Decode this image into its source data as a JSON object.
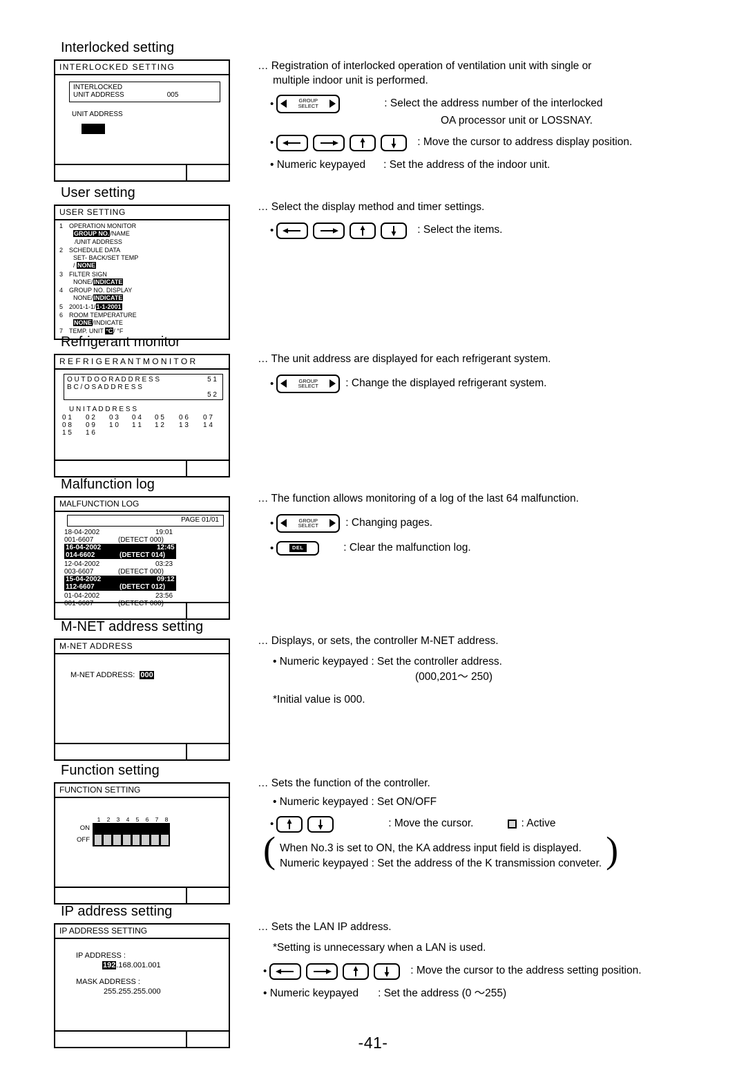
{
  "page": {
    "number": "-41-"
  },
  "sections": [
    {
      "title": "Interlocked setting",
      "screen_title": "INTERLOCKED  SETTING",
      "inner": {
        "line1": "INTERLOCKED",
        "line2": "UNIT  ADDRESS",
        "value": "005"
      },
      "field_label": "UNIT  ADDRESS",
      "desc_lead1": "… Registration of interlocked operation of ventilation unit with single or",
      "desc_lead2": "multiple indoor unit is performed.",
      "bullets": [
        {
          "key": "group-select",
          "key_top": "GROUP",
          "key_bottom": "SELECT",
          "text1": ": Select the address number of the interlocked",
          "text2": "OA processor unit or LOSSNAY."
        },
        {
          "key": "arrows4",
          "text1": ": Move the cursor to address display position."
        },
        {
          "key": "text",
          "label": "• Numeric keypayed",
          "text1": ": Set the address of the indoor unit."
        }
      ]
    },
    {
      "title": "User setting",
      "screen_title": "USER  SETTING",
      "items": [
        {
          "no": "1",
          "l1_pre": "OPERATION MONITOR",
          "l2_inv": "GROUP NO.",
          "l2_post": "/NAME",
          "l3": "/UNIT  ADDRESS"
        },
        {
          "no": "2",
          "l1_pre": "SCHEDULE  DATA",
          "l2_plain": "SET- BACK/SET TEMP",
          "l3_pre": "/ ",
          "l3_inv": "NONE"
        },
        {
          "no": "3",
          "l1_pre": "FILTER SIGN",
          "l2_plain2": "NONE/",
          "l2_inv": "INDICATE"
        },
        {
          "no": "4",
          "l1_pre": "GROUP NO. DISPLAY",
          "l2_plain2": "NONE/",
          "l2_inv": "INDICATE"
        },
        {
          "no": "5",
          "l1_plain": "2001-1-1/",
          "l1_inv": "1-1-2001"
        },
        {
          "no": "6",
          "l1_pre": "ROOM TEMPERATURE",
          "l2_inv_first": "NONE",
          "l2_post": "/INDICATE"
        },
        {
          "no": "7",
          "l1_plain": "TEMP. UNIT ",
          "l1_inv": "°C",
          "l1_post": "/ °F"
        }
      ],
      "desc_lead1": "… Select the display method and timer settings.",
      "bullets": [
        {
          "key": "arrows4",
          "text1": ": Select the items."
        }
      ]
    },
    {
      "title": "Refrigerant monitor",
      "screen_title": "R E F R I G E R A N T    M O N I T O R",
      "inner_l1": "O U T D O O R      A D D R E S S",
      "inner_l1_val": "5 1",
      "inner_l2": "B C / O S       A D D R E S S",
      "inner_l2_val": "5 2",
      "unit_header": "U N I T       A D D R E S S",
      "unit_rows": [
        [
          "0 1",
          "0 2",
          "0 3",
          "0 4",
          "0 5",
          "0 6",
          "0 7"
        ],
        [
          "0 8",
          "0 9",
          "1 0",
          "1 1",
          "1 2",
          "1 3",
          "1 4"
        ],
        [
          "1 5",
          "1 6",
          "",
          "",
          "",
          "",
          ""
        ]
      ],
      "desc_lead1": "… The unit address are displayed for each refrigerant system.",
      "bullets": [
        {
          "key": "group-select",
          "key_top": "GROUP",
          "key_bottom": "SELECT",
          "text1": ": Change the displayed refrigerant system."
        }
      ]
    },
    {
      "title": "Malfunction log",
      "screen_title": "MALFUNCTION LOG",
      "page_label": "PAGE   01/01",
      "log_rows": [
        {
          "date": "18-04-2002",
          "time": "19:01",
          "code": "001-6607",
          "detect": "(DETECT   000)",
          "hl": false
        },
        {
          "date": "16-04-2002",
          "time": "12:45",
          "code": "014-6602",
          "detect": "(DETECT   014)",
          "hl": true
        },
        {
          "date": "12-04-2002",
          "time": "03:23",
          "code": "003-6607",
          "detect": "(DETECT   000)",
          "hl": false
        },
        {
          "date": "15-04-2002",
          "time": "09:12",
          "code": "112-6607",
          "detect": "(DETECT   012)",
          "hl": true
        },
        {
          "date": "01-04-2002",
          "time": "23:56",
          "code": "001-6607",
          "detect": "(DETECT   000)",
          "hl": false
        }
      ],
      "desc_lead1": "… The function allows monitoring of a log of the last 64 malfunction.",
      "bullets": [
        {
          "key": "group-select",
          "key_top": "GROUP",
          "key_bottom": "SELECT",
          "text1": ": Changing pages."
        },
        {
          "key": "del",
          "key_label": "DEL",
          "text1": ": Clear the malfunction log."
        }
      ]
    },
    {
      "title": "M-NET address setting",
      "screen_title": "M-NET  ADDRESS",
      "field_label": "M-NET  ADDRESS:",
      "field_value": "000",
      "desc_lead1": "… Displays, or sets, the controller M-NET address.",
      "line_keypad": "• Numeric keypayed : Set the controller address.",
      "line_range": "(000,201～ 250)",
      "line_initial": "*Initial value is 000."
    },
    {
      "title": "Function setting",
      "screen_title": "FUNCTION SETTING",
      "dip_numbers": [
        "1",
        "2",
        "3",
        "4",
        "5",
        "6",
        "7",
        "8"
      ],
      "dip_on_label": "ON",
      "dip_off_label": "OFF",
      "desc_lead1": "… Sets the function of the controller.",
      "line_keypad": "• Numeric keypayed : Set ON/OFF",
      "bullets": [
        {
          "key": "arrows2",
          "text1": ": Move the cursor.",
          "active_text": ": Active"
        }
      ],
      "note_l1": "When No.3 is set to ON, the KA address input field is displayed.",
      "note_l2": "Numeric keypayed : Set the address of the K transmission conveter."
    },
    {
      "title": "IP address setting",
      "screen_title": "IP ADDRESS SETTING",
      "ip_label": "IP ADDRESS :",
      "ip_inv": "192",
      "ip_rest": ".168.001.001",
      "mask_label": "MASK ADDRESS :",
      "mask_value": "255.255.255.000",
      "desc_lead1": "… Sets the LAN IP address.",
      "line_note": "*Setting is unnecessary when a LAN is used.",
      "bullets": [
        {
          "key": "arrows4",
          "text1": ": Move the cursor to the address setting position."
        },
        {
          "key": "text",
          "label": "• Numeric keypayed",
          "text1": ": Set the address (0 ～255)"
        }
      ]
    }
  ]
}
